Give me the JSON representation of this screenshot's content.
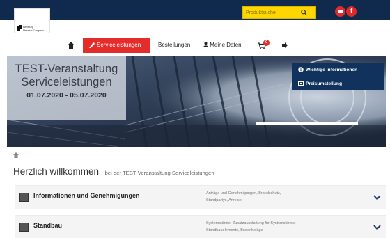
{
  "header": {
    "logo": {
      "line1": "Hamburg",
      "line2": "Messe + Congress"
    },
    "search": {
      "placeholder": "Produktsuche"
    },
    "social": {
      "facebook": "f"
    }
  },
  "nav": {
    "items": [
      {
        "label": "Serviceleistungen",
        "active": true
      },
      {
        "label": "Bestellungen"
      },
      {
        "label": "Meine Daten"
      }
    ],
    "cart_badge": "0"
  },
  "hero": {
    "title_line1": "TEST-Veranstaltung",
    "title_line2": "Serviceleistungen",
    "dates": "01.07.2020 - 05.07.2020",
    "side_buttons": [
      {
        "label": "Wichtige Informationen",
        "icon": "info-icon"
      },
      {
        "label": "Preisumstellung",
        "icon": "money-icon"
      }
    ]
  },
  "welcome": {
    "title": "Herzlich willkommen",
    "subtitle": "bei der TEST-Veranstaltung Serviceleistungen"
  },
  "accordions": [
    {
      "title": "Informationen und Genehmigungen",
      "desc_line1": "Anträge und Genehmigungen, Brandschutz,",
      "desc_line2": "Standpartys, Anreise",
      "icon": "document-icon"
    },
    {
      "title": "Standbau",
      "desc_line1": "Systemstände, Zusatzausstattung für Systemstände,",
      "desc_line2": "Standbauelemente, Bodenbeläge",
      "icon": "stand-icon"
    }
  ],
  "colors": {
    "header_bg": "#0f2a4d",
    "accent_red": "#e62b2b",
    "search_yellow": "#ffd600",
    "side_button_bg": "#10325c"
  }
}
